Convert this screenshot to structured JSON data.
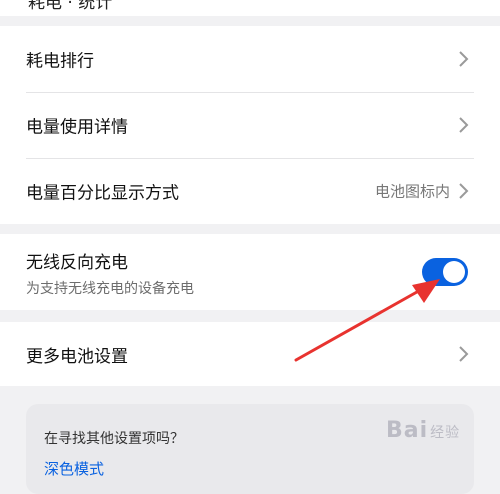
{
  "top_strip": {
    "clipped_text": "耗电 · 统计"
  },
  "list": {
    "items": [
      {
        "label": "耗电排行"
      },
      {
        "label": "电量使用详情"
      },
      {
        "label": "电量百分比显示方式",
        "value": "电池图标内"
      }
    ]
  },
  "wireless": {
    "title": "无线反向充电",
    "subtitle": "为支持无线充电的设备充电",
    "enabled": true
  },
  "more": {
    "label": "更多电池设置"
  },
  "search_suggest": {
    "question": "在寻找其他设置项吗？",
    "link": "深色模式"
  },
  "watermark": {
    "text": "Bai",
    "suffix": "经验"
  },
  "colors": {
    "accent": "#0a62e0",
    "annotation_arrow": "#e8332f",
    "background": "#f1f1f3"
  }
}
